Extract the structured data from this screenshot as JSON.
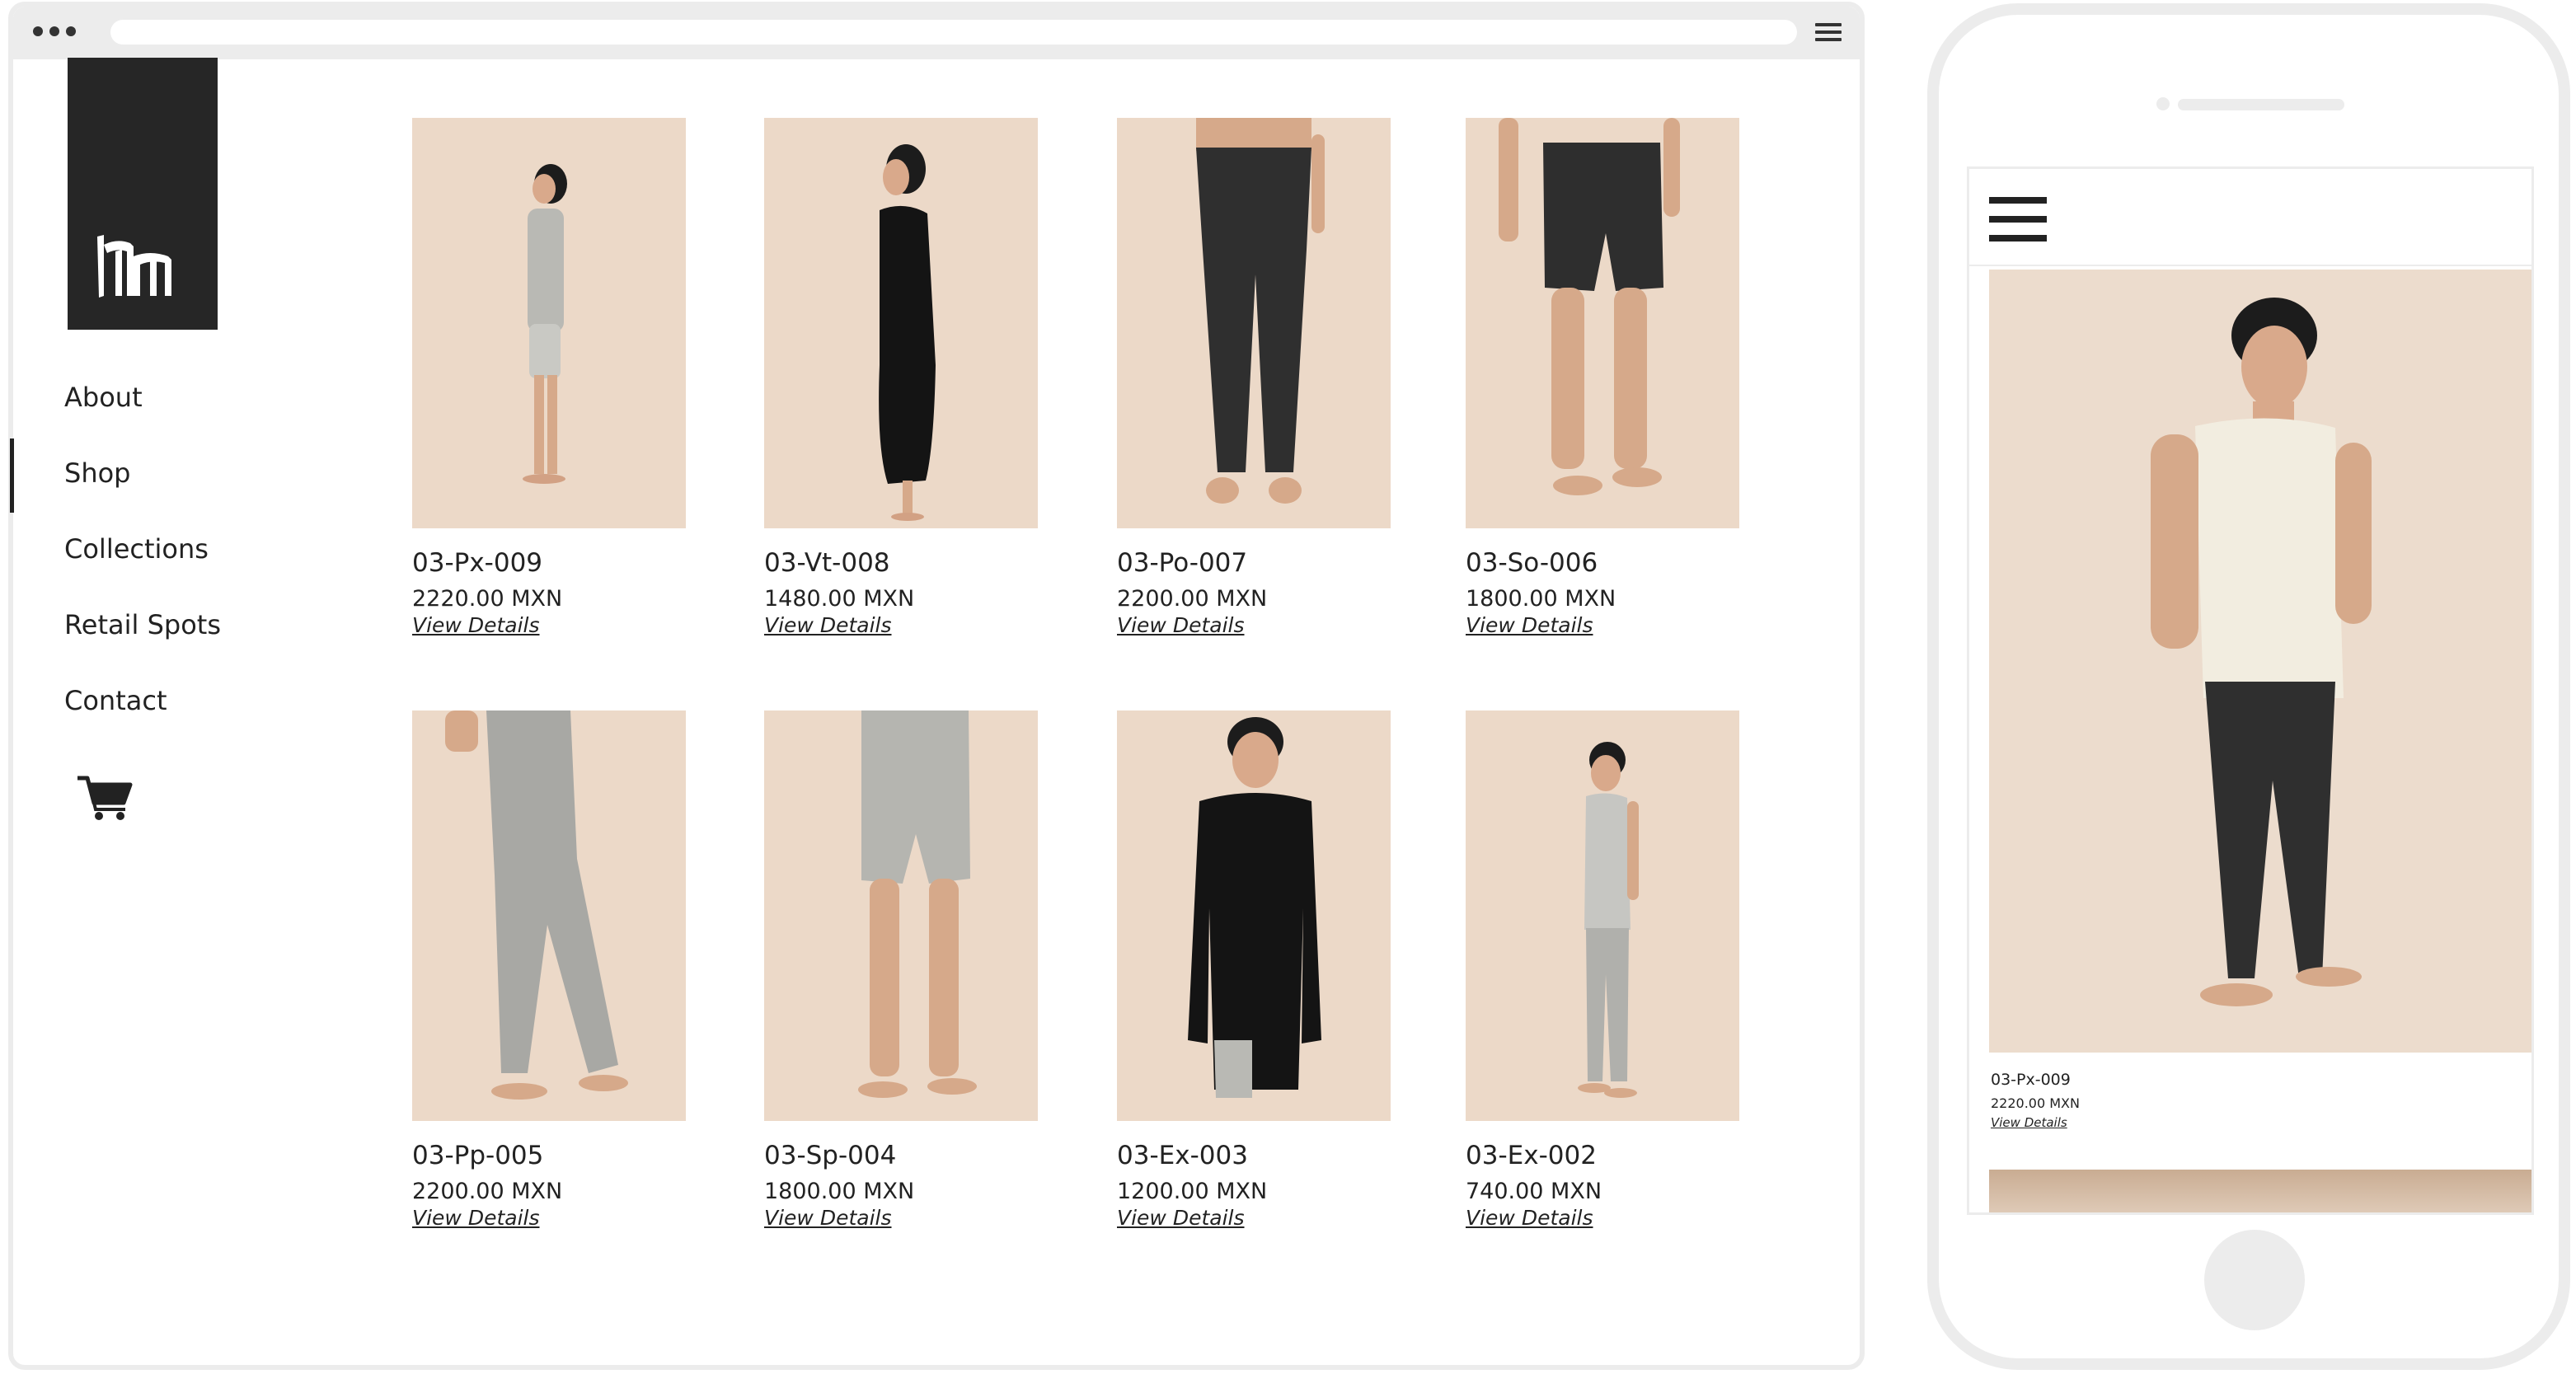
{
  "nav": {
    "items": [
      {
        "label": "About"
      },
      {
        "label": "Shop"
      },
      {
        "label": "Collections"
      },
      {
        "label": "Retail Spots"
      },
      {
        "label": "Contact"
      }
    ],
    "active": "Shop"
  },
  "products": [
    {
      "name": "03-Px-009",
      "price": "2220.00 MXN",
      "link": "View Details"
    },
    {
      "name": "03-Vt-008",
      "price": "1480.00 MXN",
      "link": "View Details"
    },
    {
      "name": "03-Po-007",
      "price": "2200.00 MXN",
      "link": "View Details"
    },
    {
      "name": "03-So-006",
      "price": "1800.00 MXN",
      "link": "View Details"
    },
    {
      "name": "03-Pp-005",
      "price": "2200.00 MXN",
      "link": "View Details"
    },
    {
      "name": "03-Sp-004",
      "price": "1800.00 MXN",
      "link": "View Details"
    },
    {
      "name": "03-Ex-003",
      "price": "1200.00 MXN",
      "link": "View Details"
    },
    {
      "name": "03-Ex-002",
      "price": "740.00 MXN",
      "link": "View Details"
    }
  ],
  "mobile": {
    "product": {
      "name": "03-Px-009",
      "price": "2220.00 MXN",
      "link": "View Details"
    }
  },
  "colors": {
    "photo_bg": "#ecd9c8",
    "logo_bg": "#262626",
    "frame": "#ececec",
    "text": "#222222"
  },
  "icons": [
    "browser-dots-icon",
    "hamburger-menu-icon",
    "cart-icon",
    "logo-mark"
  ]
}
